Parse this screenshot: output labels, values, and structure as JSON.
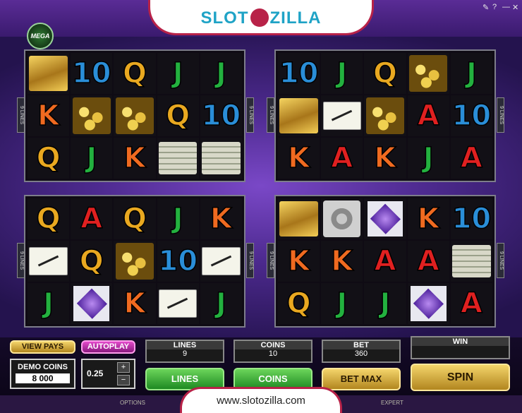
{
  "header": {
    "logo_left": "SLOT",
    "logo_right": "ZILLA",
    "tool_1": "✎",
    "tool_2": "?",
    "tool_3": "—",
    "tool_4": "✕",
    "mega_badge": "MEGA"
  },
  "reels": [
    {
      "cells": [
        "gold",
        "10",
        "Q",
        "J",
        "J",
        "K",
        "coins",
        "coins",
        "Q",
        "10",
        "Q",
        "J",
        "K",
        "money",
        "money"
      ]
    },
    {
      "cells": [
        "10",
        "J",
        "Q",
        "coins",
        "J",
        "gold",
        "cheque",
        "coins",
        "A",
        "10",
        "K",
        "A",
        "K",
        "J",
        "A"
      ]
    },
    {
      "cells": [
        "Q",
        "A",
        "Q",
        "J",
        "K",
        "cheque",
        "Q",
        "coins",
        "10",
        "cheque",
        "J",
        "gem",
        "K",
        "cheque",
        "J"
      ]
    },
    {
      "cells": [
        "gold",
        "vault",
        "gem",
        "K",
        "10",
        "K",
        "K",
        "A",
        "A",
        "money",
        "Q",
        "J",
        "J",
        "gem",
        "A"
      ]
    }
  ],
  "lines_tag": "9 LINES",
  "controls": {
    "view_pays": "VIEW PAYS",
    "autoplay": "AUTOPLAY",
    "demo_coins_label": "DEMO COINS",
    "demo_coins_value": "8 000",
    "coin_size": "0.25",
    "plus": "+",
    "minus": "−",
    "lines_label": "LINES",
    "lines_value": "9",
    "coins_label": "COINS",
    "coins_value": "10",
    "bet_label": "BET",
    "bet_value": "360",
    "win_label": "WIN",
    "win_value": "",
    "lines_button": "LINES",
    "coins_button": "COINS",
    "bet_max_button": "BET MAX",
    "spin_button": "SPIN"
  },
  "footer": {
    "url": "www.slotozilla.com",
    "options": "OPTIONS",
    "expert": "EXPERT"
  },
  "colors": {
    "accent": "#b82248",
    "logo_blue": "#1fa3c6",
    "button_green": "#1e8a22",
    "button_gold": "#b2861f"
  }
}
